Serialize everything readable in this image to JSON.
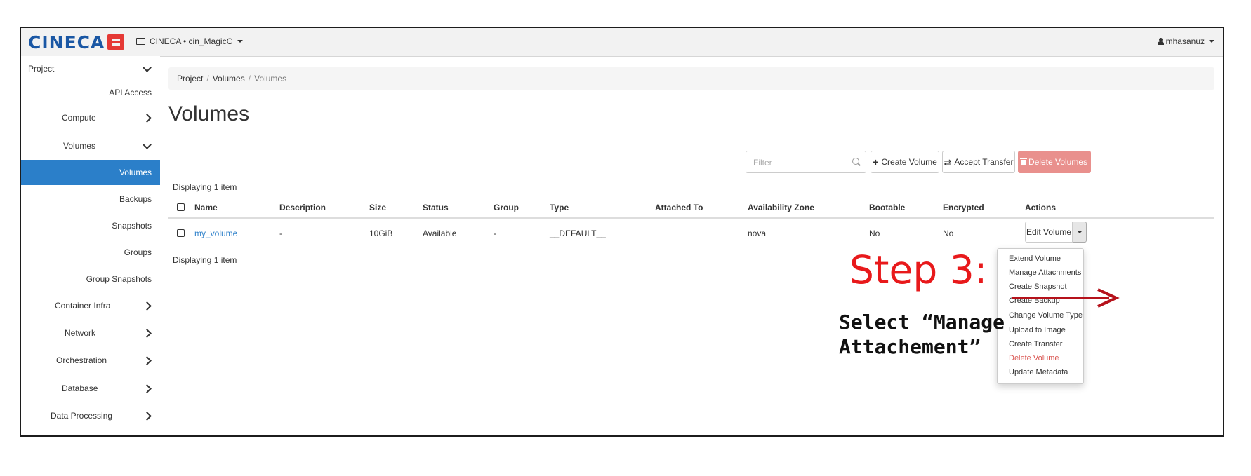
{
  "header": {
    "logo_text": "CINECA",
    "project_selector": "CINECA • cin_MagicC",
    "user": "mhasanuz"
  },
  "sidebar": {
    "items": [
      {
        "label": "Project",
        "chevron": "down"
      },
      {
        "label": "API Access"
      },
      {
        "label": "Compute",
        "chevron": "right"
      },
      {
        "label": "Volumes",
        "chevron": "down"
      },
      {
        "label": "Volumes",
        "active": true
      },
      {
        "label": "Backups"
      },
      {
        "label": "Snapshots"
      },
      {
        "label": "Groups"
      },
      {
        "label": "Group Snapshots"
      },
      {
        "label": "Container Infra",
        "chevron": "right"
      },
      {
        "label": "Network",
        "chevron": "right"
      },
      {
        "label": "Orchestration",
        "chevron": "right"
      },
      {
        "label": "Database",
        "chevron": "right"
      },
      {
        "label": "Data Processing",
        "chevron": "right"
      }
    ]
  },
  "breadcrumb": [
    "Project",
    "Volumes",
    "Volumes"
  ],
  "page_title": "Volumes",
  "toolbar": {
    "filter_placeholder": "Filter",
    "create_label": "Create Volume",
    "transfer_label": "Accept Transfer",
    "delete_label": "Delete Volumes"
  },
  "table": {
    "display_count": "Displaying 1 item",
    "columns": [
      "Name",
      "Description",
      "Size",
      "Status",
      "Group",
      "Type",
      "Attached To",
      "Availability Zone",
      "Bootable",
      "Encrypted",
      "Actions"
    ],
    "rows": [
      {
        "name": "my_volume",
        "description": "-",
        "size": "10GiB",
        "status": "Available",
        "group": "-",
        "type": "__DEFAULT__",
        "attached_to": "",
        "availability_zone": "nova",
        "bootable": "No",
        "encrypted": "No",
        "action": "Edit Volume"
      }
    ]
  },
  "actions_menu": [
    "Extend Volume",
    "Manage Attachments",
    "Create Snapshot",
    "Create Backup",
    "Change Volume Type",
    "Upload to Image",
    "Create Transfer",
    "Delete Volume",
    "Update Metadata"
  ],
  "annotation": {
    "title": "Step 3:",
    "line1": "Select “Manage",
    "line2": "Attachement”"
  },
  "colors": {
    "accent": "#2b7fc9",
    "danger": "#d9534f",
    "annotation": "#e8191b",
    "arrow": "#b5121b"
  }
}
